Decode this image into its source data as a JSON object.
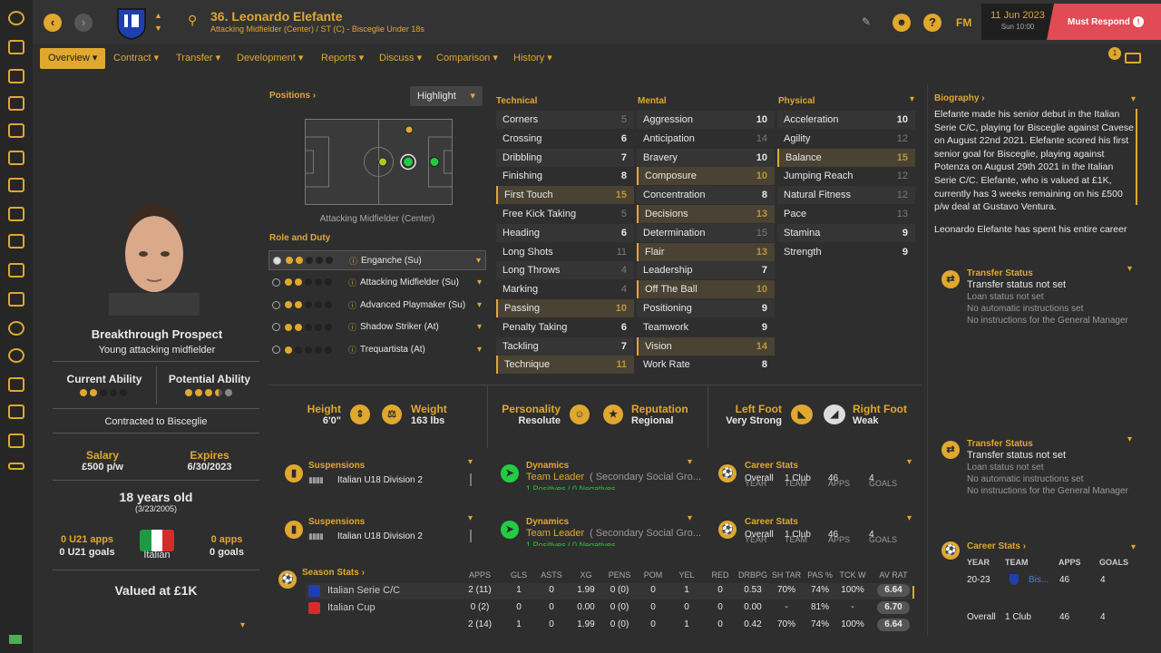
{
  "player": {
    "number_name": "36. Leonardo Elefante",
    "subtitle": "Attacking Midfielder (Center) / ST (C) - Bisceglie Under 18s",
    "rating_label": "Breakthrough Prospect",
    "description": "Young attacking midfielder",
    "contract": "Contracted to Bisceglie",
    "age": "18 years old",
    "dob": "(3/23/2005)",
    "nationality": "Italian",
    "value": "Valued at £1K"
  },
  "header": {
    "date": "11 Jun 2023",
    "time": "Sun 10:00",
    "must_respond": "Must Respond",
    "fm": "FM"
  },
  "tabs": [
    "Overview",
    "Contract",
    "Transfer",
    "Development",
    "Reports",
    "Discuss",
    "Comparison",
    "History"
  ],
  "positions": {
    "title": "Positions",
    "highlight": "Highlight",
    "position_label": "Attacking Midfielder (Center)"
  },
  "roles": {
    "title": "Role and Duty",
    "items": [
      {
        "name": "Enganche (Su)",
        "stars": 2
      },
      {
        "name": "Attacking Midfielder (Su)",
        "stars": 2
      },
      {
        "name": "Advanced Playmaker (Su)",
        "stars": 2
      },
      {
        "name": "Shadow Striker (At)",
        "stars": 2
      },
      {
        "name": "Trequartista (At)",
        "stars": 1
      }
    ]
  },
  "ability": {
    "current_label": "Current Ability",
    "potential_label": "Potential Ability",
    "current_stars": 2,
    "potential_stars": 3.5
  },
  "contract": {
    "salary_label": "Salary",
    "salary": "£500 p/w",
    "expires_label": "Expires",
    "expires": "6/30/2023"
  },
  "intl": {
    "u21_apps": "0 U21 apps",
    "u21_goals": "0 U21 goals",
    "apps": "0 apps",
    "goals": "0 goals"
  },
  "attributes": {
    "technical_title": "Technical",
    "mental_title": "Mental",
    "physical_title": "Physical",
    "technical": [
      {
        "n": "Corners",
        "v": "5"
      },
      {
        "n": "Crossing",
        "v": "6"
      },
      {
        "n": "Dribbling",
        "v": "7"
      },
      {
        "n": "Finishing",
        "v": "8"
      },
      {
        "n": "First Touch",
        "v": "15",
        "h": true
      },
      {
        "n": "Free Kick Taking",
        "v": "5"
      },
      {
        "n": "Heading",
        "v": "6"
      },
      {
        "n": "Long Shots",
        "v": "11"
      },
      {
        "n": "Long Throws",
        "v": "4"
      },
      {
        "n": "Marking",
        "v": "4"
      },
      {
        "n": "Passing",
        "v": "10",
        "h": true
      },
      {
        "n": "Penalty Taking",
        "v": "6"
      },
      {
        "n": "Tackling",
        "v": "7"
      },
      {
        "n": "Technique",
        "v": "11",
        "h": true
      }
    ],
    "mental": [
      {
        "n": "Aggression",
        "v": "10"
      },
      {
        "n": "Anticipation",
        "v": "14"
      },
      {
        "n": "Bravery",
        "v": "10"
      },
      {
        "n": "Composure",
        "v": "10",
        "h": true
      },
      {
        "n": "Concentration",
        "v": "8"
      },
      {
        "n": "Decisions",
        "v": "13",
        "h": true
      },
      {
        "n": "Determination",
        "v": "15"
      },
      {
        "n": "Flair",
        "v": "13",
        "h": true
      },
      {
        "n": "Leadership",
        "v": "7"
      },
      {
        "n": "Off The Ball",
        "v": "10",
        "h": true
      },
      {
        "n": "Positioning",
        "v": "9"
      },
      {
        "n": "Teamwork",
        "v": "9"
      },
      {
        "n": "Vision",
        "v": "14",
        "h": true
      },
      {
        "n": "Work Rate",
        "v": "8"
      }
    ],
    "physical": [
      {
        "n": "Acceleration",
        "v": "10"
      },
      {
        "n": "Agility",
        "v": "12"
      },
      {
        "n": "Balance",
        "v": "15",
        "h": true
      },
      {
        "n": "Jumping Reach",
        "v": "12"
      },
      {
        "n": "Natural Fitness",
        "v": "12"
      },
      {
        "n": "Pace",
        "v": "13"
      },
      {
        "n": "Stamina",
        "v": "9"
      },
      {
        "n": "Strength",
        "v": "9"
      }
    ]
  },
  "info": {
    "height_label": "Height",
    "height": "6'0\"",
    "weight_label": "Weight",
    "weight": "163 lbs",
    "personality_label": "Personality",
    "personality": "Resolute",
    "reputation_label": "Reputation",
    "reputation": "Regional",
    "left_foot_label": "Left Foot",
    "left_foot": "Very Strong",
    "right_foot_label": "Right Foot",
    "right_foot": "Weak"
  },
  "widgets": {
    "suspensions": "Suspensions",
    "susp_comp": "Italian U18 Division 2",
    "dynamics": "Dynamics",
    "dyn_role": "Team Leader",
    "dyn_group": "( Secondary Social Gro...",
    "dyn_sub": "1 Positives / 0 Negatives",
    "career": "Career Stats",
    "year": "YEAR",
    "team": "TEAM",
    "apps": "APPS",
    "goals": "GOALS",
    "overall": "Overall",
    "one_club": "1 Club",
    "c_apps": "46",
    "c_goals": "4"
  },
  "season": {
    "title": "Season Stats",
    "cols": [
      "APPS",
      "GLS",
      "ASTS",
      "XG",
      "PENS",
      "POM",
      "YEL",
      "RED",
      "DRBPG",
      "SH TAR",
      "PAS %",
      "TCK W",
      "AV RAT"
    ],
    "rows": [
      {
        "comp": "Italian Serie C/C",
        "vals": [
          "2 (11)",
          "1",
          "0",
          "1.99",
          "0 (0)",
          "0",
          "1",
          "0",
          "0.53",
          "70%",
          "74%",
          "100%"
        ],
        "rat": "6.64"
      },
      {
        "comp": "Italian Cup",
        "vals": [
          "0 (2)",
          "0",
          "0",
          "0.00",
          "0 (0)",
          "0",
          "0",
          "0",
          "0.00",
          "-",
          "81%",
          "-"
        ],
        "rat": "6.70"
      },
      {
        "comp": "",
        "vals": [
          "2 (14)",
          "1",
          "0",
          "1.99",
          "0 (0)",
          "0",
          "1",
          "0",
          "0.42",
          "70%",
          "74%",
          "100%"
        ],
        "rat": "6.64"
      }
    ]
  },
  "bio": {
    "title": "Biography",
    "text": "Elefante made his senior debut in the Italian Serie C/C, playing for Bisceglie against Cavese on August 22nd 2021. Elefante scored his first senior goal for Bisceglie, playing against Potenza on August 29th 2021 in the Italian Serie C/C. Elefante, who is valued at £1K, currently has 3 weeks remaining on his £500 p/w deal at Gustavo Ventura.",
    "more": "Leonardo Elefante has spent his entire career"
  },
  "transfer": {
    "title": "Transfer Status",
    "status": "Transfer status not set",
    "loan": "Loan status not set",
    "auto": "No automatic instructions set",
    "gm": "No instructions for the General Manager"
  },
  "right_career": {
    "title": "Career Stats",
    "year_val": "20-23",
    "team_val": "Bis...",
    "apps": "46",
    "goals": "4"
  },
  "badge_count": "1"
}
